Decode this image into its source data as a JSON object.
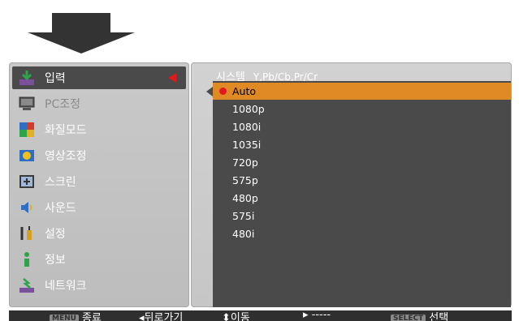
{
  "menu": {
    "items": [
      {
        "label": "입력",
        "icon": "input-icon"
      },
      {
        "label": "PC조정",
        "icon": "pc-adjust-icon"
      },
      {
        "label": "화질모드",
        "icon": "image-mode-icon"
      },
      {
        "label": "영상조정",
        "icon": "image-adjust-icon"
      },
      {
        "label": "스크린",
        "icon": "screen-icon"
      },
      {
        "label": "사운드",
        "icon": "sound-icon"
      },
      {
        "label": "설정",
        "icon": "settings-icon"
      },
      {
        "label": "정보",
        "icon": "information-icon"
      },
      {
        "label": "네트워크",
        "icon": "network-icon"
      }
    ]
  },
  "submenu": {
    "title": "시스템",
    "value": "Y,Pb/Cb,Pr/Cr",
    "options": [
      "Auto",
      "1080p",
      "1080i",
      "1035i",
      "720p",
      "575p",
      "480p",
      "575i",
      "480i"
    ],
    "selected": "Auto"
  },
  "footer": {
    "menu_badge": "MENU",
    "exit": "종료",
    "back": "뒤로가기",
    "move": "이동",
    "next": "-----",
    "select_badge": "SELECT",
    "select": "선택"
  },
  "colors": {
    "highlight": "#e08a25",
    "indicator": "#e0191e",
    "panel_dark": "#4a4a4a"
  }
}
